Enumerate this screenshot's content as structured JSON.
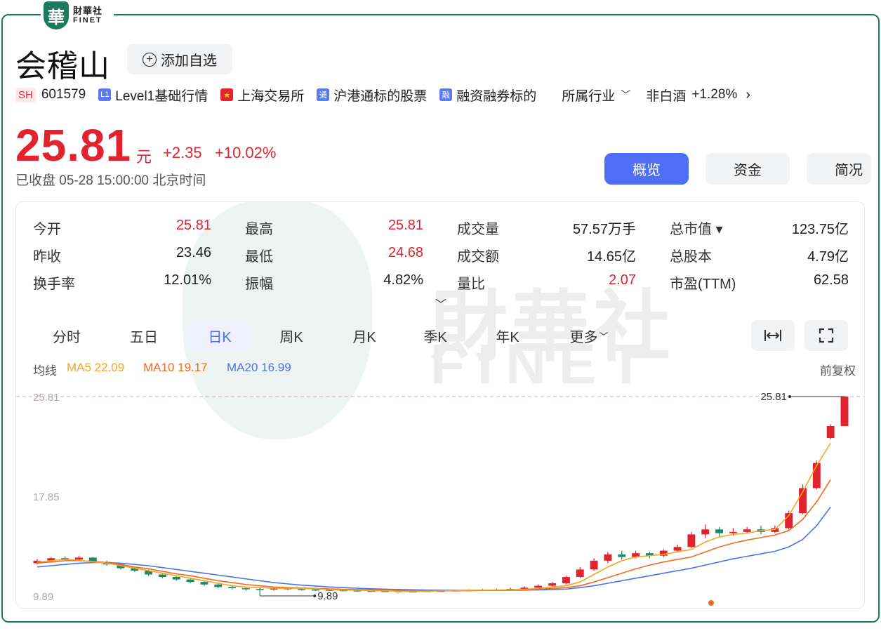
{
  "logo": {
    "badge": "華",
    "name_zh": "財華社",
    "name_en": "FINET"
  },
  "stock": {
    "name": "会稽山",
    "watch_button": "添加自选",
    "exchange_tag": "SH",
    "code": "601579",
    "tags": [
      "Level1基础行情",
      "上海交易所",
      "沪港通标的股票",
      "融资融券标的"
    ],
    "tag_icons": [
      "L1",
      "★",
      "通",
      "融"
    ],
    "industry_label": "所属行业",
    "sector": "非白酒",
    "sector_change": "+1.28%"
  },
  "quote": {
    "price": "25.81",
    "unit": "元",
    "change": "+2.35",
    "change_pct": "+10.02%",
    "status": "已收盘  05-28 15:00:00  北京时间"
  },
  "nav_tabs": [
    "概览",
    "资金",
    "简况"
  ],
  "stats": [
    [
      {
        "label": "今开",
        "value": "25.81",
        "color": "red"
      },
      {
        "label": "最高",
        "value": "25.81",
        "color": "red"
      },
      {
        "label": "成交量",
        "value": "57.57万手",
        "color": "black"
      },
      {
        "label": "总市值 ▾",
        "value": "123.75亿",
        "color": "black"
      }
    ],
    [
      {
        "label": "昨收",
        "value": "23.46",
        "color": "black"
      },
      {
        "label": "最低",
        "value": "24.68",
        "color": "red"
      },
      {
        "label": "成交额",
        "value": "14.65亿",
        "color": "black"
      },
      {
        "label": "总股本",
        "value": "4.79亿",
        "color": "black"
      }
    ],
    [
      {
        "label": "换手率",
        "value": "12.01%",
        "color": "black"
      },
      {
        "label": "振幅",
        "value": "4.82%",
        "color": "black"
      },
      {
        "label": "量比",
        "value": "2.07",
        "color": "red"
      },
      {
        "label": "市盈(TTM)",
        "value": "62.58",
        "color": "black"
      }
    ]
  ],
  "kline_tabs": [
    "分时",
    "五日",
    "日K",
    "周K",
    "月K",
    "季K",
    "年K",
    "更多"
  ],
  "kline_active": "日K",
  "ma": {
    "label": "均线",
    "ma5": "MA5 22.09",
    "ma10": "MA10 19.17",
    "ma20": "MA20 16.99",
    "adjust": "前复权",
    "colors": {
      "ma5": "#f5a623",
      "ma10": "#f06a22",
      "ma20": "#4a74e8",
      "up": "#e0232e",
      "down": "#1a8a6a"
    }
  },
  "watermark": {
    "zh": "財華社",
    "en": "FINET"
  },
  "chart_data": {
    "type": "candlestick",
    "y_ticks": [
      "25.81",
      "17.85",
      "9.89"
    ],
    "ylim": [
      9.89,
      25.81
    ],
    "high_label": "25.81",
    "low_label": "9.89",
    "ma5": [
      12.6,
      12.7,
      12.8,
      12.75,
      12.6,
      12.5,
      12.3,
      12.1,
      11.9,
      11.7,
      11.5,
      11.3,
      11.1,
      10.9,
      10.7,
      10.6,
      10.55,
      10.5,
      10.5,
      10.48,
      10.45,
      10.4,
      10.35,
      10.35,
      10.3,
      10.3,
      10.25,
      10.25,
      10.25,
      10.3,
      10.32,
      10.34,
      10.35,
      10.36,
      10.38,
      10.42,
      10.5,
      10.6,
      10.7,
      11.0,
      11.6,
      12.2,
      12.7,
      13.0,
      13.1,
      13.2,
      13.4,
      13.6,
      14.2,
      14.6,
      14.8,
      14.9,
      15.1,
      15.2,
      16.3,
      18.2,
      20.3,
      22.09
    ],
    "ma10": [
      12.5,
      12.6,
      12.7,
      12.7,
      12.65,
      12.55,
      12.4,
      12.2,
      12.05,
      11.85,
      11.65,
      11.5,
      11.3,
      11.1,
      10.95,
      10.8,
      10.7,
      10.6,
      10.55,
      10.52,
      10.48,
      10.45,
      10.42,
      10.4,
      10.38,
      10.35,
      10.32,
      10.3,
      10.3,
      10.3,
      10.3,
      10.31,
      10.32,
      10.33,
      10.35,
      10.38,
      10.43,
      10.48,
      10.55,
      10.7,
      11.0,
      11.35,
      11.7,
      12.05,
      12.35,
      12.6,
      12.8,
      13.0,
      13.4,
      13.8,
      14.1,
      14.35,
      14.55,
      14.75,
      15.1,
      16.0,
      17.4,
      19.17
    ],
    "ma20": [
      12.2,
      12.3,
      12.4,
      12.5,
      12.55,
      12.55,
      12.5,
      12.4,
      12.3,
      12.15,
      12.0,
      11.85,
      11.7,
      11.55,
      11.4,
      11.25,
      11.1,
      10.95,
      10.85,
      10.75,
      10.68,
      10.6,
      10.55,
      10.5,
      10.46,
      10.43,
      10.4,
      10.38,
      10.36,
      10.35,
      10.34,
      10.33,
      10.33,
      10.33,
      10.34,
      10.35,
      10.37,
      10.4,
      10.43,
      10.55,
      10.7,
      10.9,
      11.1,
      11.3,
      11.5,
      11.7,
      11.9,
      12.1,
      12.35,
      12.6,
      12.85,
      13.05,
      13.25,
      13.45,
      13.8,
      14.4,
      15.5,
      16.99
    ],
    "candles": [
      [
        12.5,
        12.7,
        12.85,
        12.4
      ],
      [
        12.7,
        12.9,
        13.0,
        12.6
      ],
      [
        12.9,
        12.8,
        13.05,
        12.7
      ],
      [
        12.8,
        12.95,
        13.1,
        12.7
      ],
      [
        12.95,
        12.6,
        13.0,
        12.5
      ],
      [
        12.6,
        12.4,
        12.7,
        12.3
      ],
      [
        12.4,
        12.1,
        12.5,
        12.0
      ],
      [
        12.1,
        11.9,
        12.2,
        11.8
      ],
      [
        11.9,
        11.6,
        12.0,
        11.5
      ],
      [
        11.6,
        11.4,
        11.7,
        11.3
      ],
      [
        11.4,
        11.2,
        11.5,
        11.1
      ],
      [
        11.2,
        11.0,
        11.3,
        10.9
      ],
      [
        11.0,
        10.8,
        11.1,
        10.7
      ],
      [
        10.8,
        10.6,
        10.9,
        10.5
      ],
      [
        10.6,
        10.5,
        10.7,
        10.4
      ],
      [
        10.5,
        10.45,
        10.6,
        10.3
      ],
      [
        10.45,
        10.4,
        10.55,
        9.89
      ],
      [
        10.4,
        10.5,
        10.6,
        10.3
      ],
      [
        10.5,
        10.45,
        10.6,
        10.35
      ],
      [
        10.45,
        10.4,
        10.5,
        10.3
      ],
      [
        10.4,
        10.38,
        10.5,
        10.3
      ],
      [
        10.38,
        10.35,
        10.45,
        10.28
      ],
      [
        10.35,
        10.33,
        10.42,
        10.25
      ],
      [
        10.33,
        10.3,
        10.4,
        10.22
      ],
      [
        10.3,
        10.28,
        10.38,
        10.2
      ],
      [
        10.28,
        10.27,
        10.35,
        10.2
      ],
      [
        10.27,
        10.25,
        10.33,
        10.18
      ],
      [
        10.25,
        10.24,
        10.32,
        10.17
      ],
      [
        10.24,
        10.28,
        10.35,
        10.2
      ],
      [
        10.28,
        10.3,
        10.38,
        10.22
      ],
      [
        10.3,
        10.33,
        10.4,
        10.25
      ],
      [
        10.33,
        10.35,
        10.42,
        10.28
      ],
      [
        10.35,
        10.37,
        10.45,
        10.3
      ],
      [
        10.37,
        10.4,
        10.48,
        10.32
      ],
      [
        10.4,
        10.45,
        10.55,
        10.35
      ],
      [
        10.45,
        10.55,
        10.65,
        10.4
      ],
      [
        10.55,
        10.7,
        10.8,
        10.5
      ],
      [
        10.7,
        10.9,
        11.0,
        10.6
      ],
      [
        10.9,
        11.4,
        11.5,
        10.8
      ],
      [
        11.4,
        12.0,
        12.2,
        11.3
      ],
      [
        12.0,
        12.7,
        12.9,
        11.9
      ],
      [
        12.7,
        13.2,
        13.4,
        12.5
      ],
      [
        13.2,
        13.0,
        13.5,
        12.8
      ],
      [
        13.0,
        13.3,
        13.5,
        12.9
      ],
      [
        13.3,
        13.1,
        13.4,
        12.9
      ],
      [
        13.1,
        13.5,
        13.6,
        13.0
      ],
      [
        13.5,
        13.8,
        14.0,
        13.4
      ],
      [
        13.8,
        14.8,
        15.0,
        13.7
      ],
      [
        14.8,
        15.2,
        15.6,
        14.5
      ],
      [
        15.2,
        14.9,
        15.4,
        14.6
      ],
      [
        14.9,
        15.0,
        15.3,
        14.7
      ],
      [
        15.0,
        15.2,
        15.4,
        14.9
      ],
      [
        15.2,
        15.0,
        15.5,
        14.8
      ],
      [
        15.0,
        15.3,
        15.5,
        14.9
      ],
      [
        15.3,
        16.5,
        16.7,
        15.2
      ],
      [
        16.5,
        18.5,
        18.8,
        16.4
      ],
      [
        18.5,
        20.5,
        20.7,
        18.4
      ],
      [
        22.5,
        23.46,
        23.6,
        22.4
      ],
      [
        23.46,
        25.81,
        25.81,
        24.68
      ]
    ]
  }
}
